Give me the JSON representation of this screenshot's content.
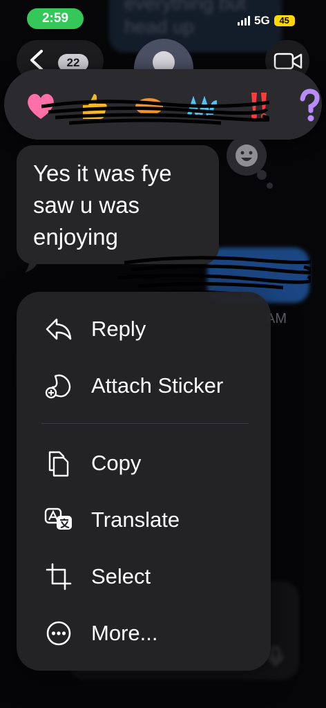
{
  "background": {
    "top_bubble_text": "everything but\nhead up",
    "timestamp": "AM"
  },
  "status_bar": {
    "time": "2:59",
    "network": "5G",
    "battery": "45"
  },
  "nav": {
    "back_count": "22"
  },
  "reactions": [
    {
      "name": "heart-reaction",
      "emoji": "❤️"
    },
    {
      "name": "thumbs-up-reaction",
      "emoji": "👍"
    },
    {
      "name": "reaction-3",
      "emoji": ""
    },
    {
      "name": "reaction-4",
      "emoji": ""
    },
    {
      "name": "exclamation-reaction",
      "emoji": "‼️"
    },
    {
      "name": "question-reaction",
      "emoji": "?"
    }
  ],
  "message": {
    "text": "Yes it was fye saw u was enjoying"
  },
  "menu": {
    "items": [
      {
        "label": "Reply",
        "icon": "reply-icon"
      },
      {
        "label": "Attach Sticker",
        "icon": "sticker-icon"
      },
      {
        "label": "Copy",
        "icon": "copy-icon"
      },
      {
        "label": "Translate",
        "icon": "translate-icon"
      },
      {
        "label": "Select",
        "icon": "crop-icon"
      },
      {
        "label": "More...",
        "icon": "more-icon"
      }
    ]
  },
  "colors": {
    "status_green": "#34c759",
    "imessage_blue": "#2d7be6",
    "battery_yellow": "#ffd60a"
  }
}
